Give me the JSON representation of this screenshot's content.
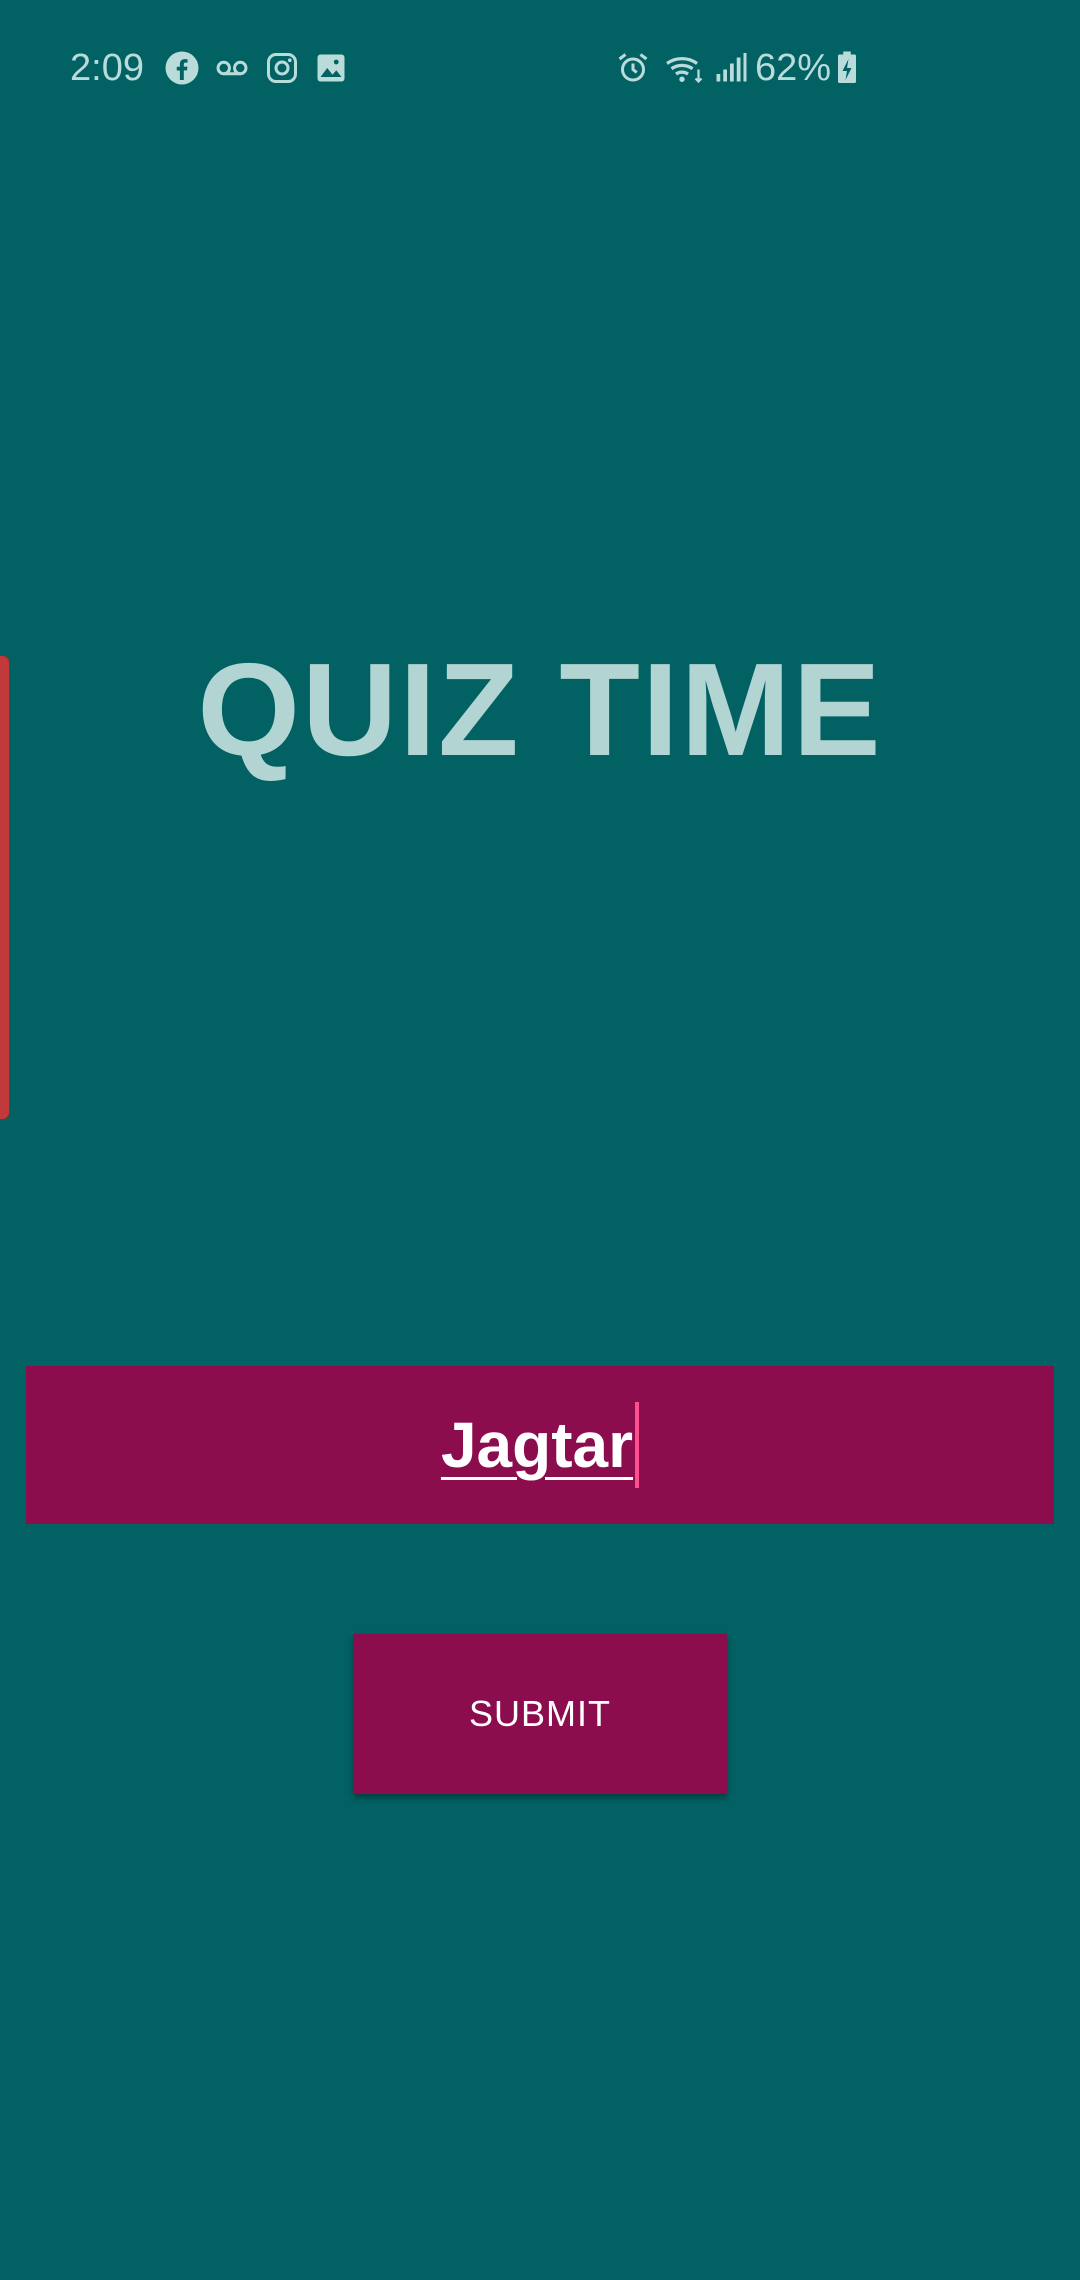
{
  "status_bar": {
    "time": "2:09",
    "battery_percent": "62%",
    "left_icons": [
      "facebook-icon",
      "voicemail-icon",
      "instagram-icon",
      "gallery-icon"
    ],
    "right_icons": [
      "alarm-icon",
      "wifi-icon",
      "signal-icon",
      "battery-charging-icon"
    ]
  },
  "title": "QUIZ TIME",
  "name_input": {
    "value": "Jagtar"
  },
  "submit_label": "SUBMIT",
  "colors": {
    "background": "#026163",
    "accent": "#8b0d4e",
    "title": "#b2d5d3",
    "caret": "#ff4f8e",
    "edge_handle": "#c0393b"
  }
}
